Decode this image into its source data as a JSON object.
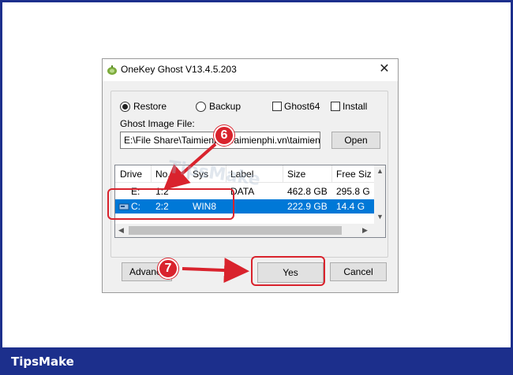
{
  "brand": "TipsMake",
  "dialog": {
    "title": "OneKey Ghost V13.4.5.203",
    "close_glyph": "✕",
    "options": {
      "restore": "Restore",
      "backup": "Backup",
      "ghost64": "Ghost64",
      "install": "Install"
    },
    "ghost_image_label": "Ghost Image File:",
    "ghost_image_path": "E:\\File Share\\Taimienphi\\Taimienphi.vn\\taimienphi\\ghos",
    "open_button": "Open",
    "table": {
      "columns": [
        "Drive",
        "No.",
        "Sys",
        "Label",
        "Size",
        "Free Siz"
      ],
      "rows": [
        {
          "drive": "E:",
          "no": "1:2",
          "sys": "",
          "label": "DATA",
          "size": "462.8 GB",
          "free": "295.8 G"
        },
        {
          "drive": "C:",
          "no": "2:2",
          "sys": "WIN8",
          "label": "",
          "size": "222.9 GB",
          "free": "14.4 G"
        }
      ]
    },
    "advanced_button": "Advanc",
    "yes_button": "Yes",
    "cancel_button": "Cancel"
  },
  "annotations": {
    "step6": "6",
    "step7": "7",
    "accent": "#d9232d"
  },
  "watermark": "TipsMake"
}
